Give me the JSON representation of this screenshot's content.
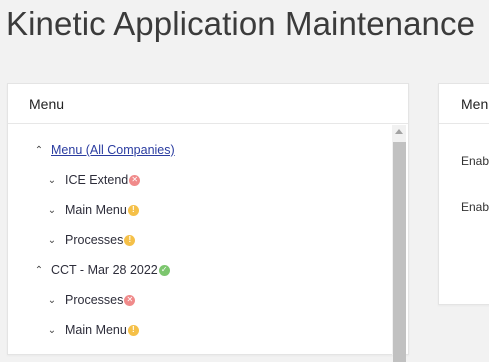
{
  "page": {
    "title": "Kinetic Application Maintenance"
  },
  "left_panel": {
    "header": "Menu",
    "tree": [
      {
        "chevron": "^",
        "label": "Menu (All Companies)",
        "link": true,
        "status": ""
      },
      {
        "chevron": "v",
        "label": "ICE Extend",
        "link": false,
        "status": "error"
      },
      {
        "chevron": "v",
        "label": "Main Menu",
        "link": false,
        "status": "warning"
      },
      {
        "chevron": "v",
        "label": "Processes",
        "link": false,
        "status": "warning"
      },
      {
        "chevron": "^",
        "label": "CCT - Mar 28 2022",
        "link": false,
        "status": "ok"
      },
      {
        "chevron": "v",
        "label": "Processes",
        "link": false,
        "status": "error"
      },
      {
        "chevron": "v",
        "label": "Main Menu",
        "link": false,
        "status": "warning"
      }
    ]
  },
  "right_panel": {
    "header": "Menu",
    "fields": [
      {
        "label": "Enabled"
      },
      {
        "label": "Enabled"
      }
    ]
  },
  "colors": {
    "error": "#f08a8a",
    "warning": "#f5c048",
    "ok": "#7cc66e",
    "link": "#2a3ca0"
  }
}
